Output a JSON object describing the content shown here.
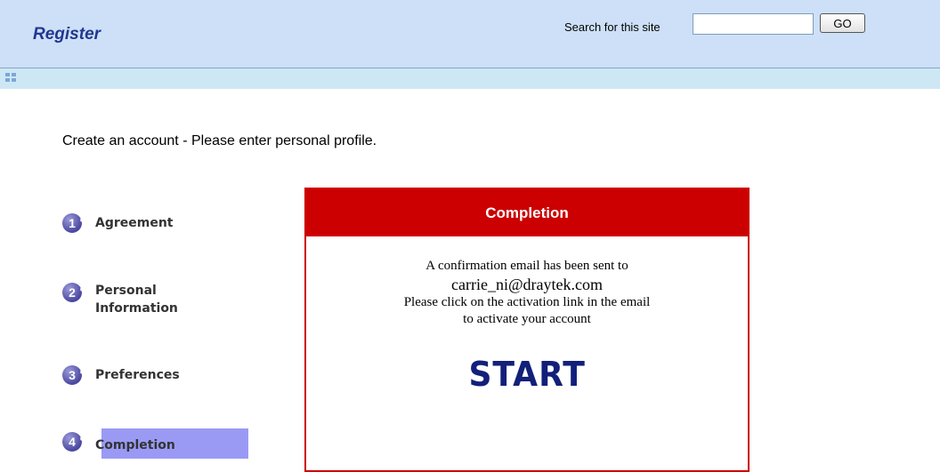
{
  "header": {
    "title": "Register",
    "search_label": "Search for this site",
    "search_value": "",
    "go_label": "GO"
  },
  "page": {
    "heading": "Create an account - Please enter personal profile."
  },
  "steps": [
    {
      "number": "1",
      "label": "Agreement"
    },
    {
      "number": "2",
      "label_line1": "Personal",
      "label_line2": "Information"
    },
    {
      "number": "3",
      "label": "Preferences"
    },
    {
      "number": "4",
      "label": "Completion",
      "active": true
    }
  ],
  "panel": {
    "title": "Completion",
    "line1": "A confirmation email has been sent to",
    "email": "carrie_ni@draytek.com",
    "line2": "Please click on the activation link in the email",
    "line3": "to activate your account",
    "start_label": "START"
  },
  "colors": {
    "header_bg": "#cde0f7",
    "panel_accent": "#cc0000",
    "active_step_bg": "#9a9af5",
    "title_blue": "#22378f"
  }
}
